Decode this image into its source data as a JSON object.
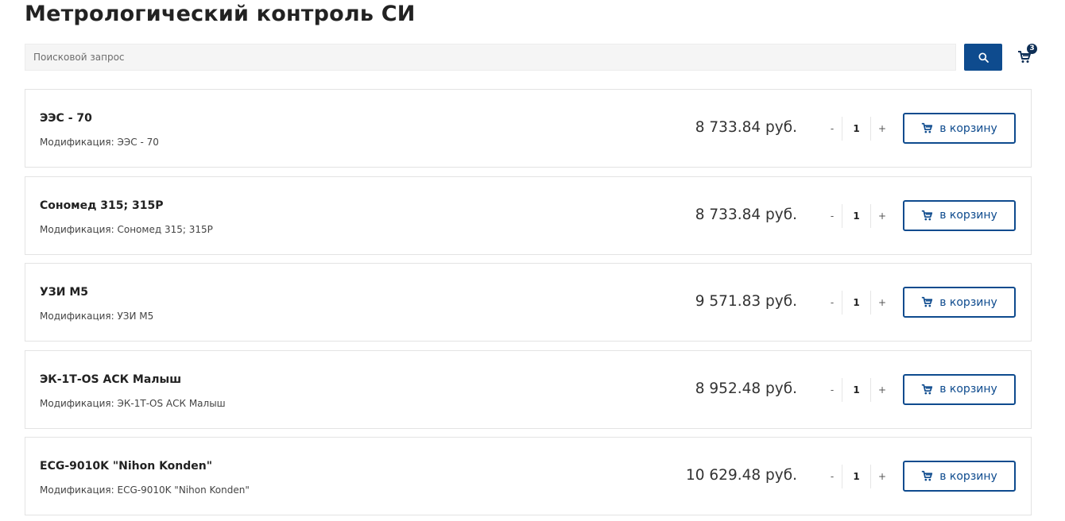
{
  "page": {
    "title": "Метрологический контроль СИ"
  },
  "search": {
    "placeholder": "Поисковой запрос",
    "button_icon": "search-icon"
  },
  "cart": {
    "icon": "cart-icon",
    "count": "3"
  },
  "colors": {
    "accent": "#0e4b8e",
    "badge": "#0e2f56",
    "border": "#e3e3e3"
  },
  "items": [
    {
      "name": "ЭЭС - 70",
      "modification": "Модификация: ЭЭС - 70",
      "price": "8 733.84 руб.",
      "minus": "-",
      "quantity": "1",
      "plus": "+",
      "add_label": "в корзину"
    },
    {
      "name": "Сономед 315; 315Р",
      "modification": "Модификация: Сономед 315; 315Р",
      "price": "8 733.84 руб.",
      "minus": "-",
      "quantity": "1",
      "plus": "+",
      "add_label": "в корзину"
    },
    {
      "name": "УЗИ М5",
      "modification": "Модификация: УЗИ М5",
      "price": "9 571.83 руб.",
      "minus": "-",
      "quantity": "1",
      "plus": "+",
      "add_label": "в корзину"
    },
    {
      "name": "ЭК-1Т-OS АСК Малыш",
      "modification": "Модификация: ЭК-1Т-OS АСК Малыш",
      "price": "8 952.48 руб.",
      "minus": "-",
      "quantity": "1",
      "plus": "+",
      "add_label": "в корзину"
    },
    {
      "name": "ECG-9010K \"Nihon Konden\"",
      "modification": "Модификация: ECG-9010K \"Nihon Konden\"",
      "price": "10 629.48 руб.",
      "minus": "-",
      "quantity": "1",
      "plus": "+",
      "add_label": "в корзину"
    }
  ]
}
